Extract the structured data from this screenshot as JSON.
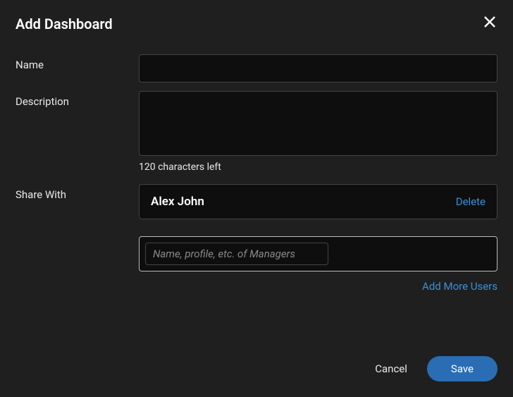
{
  "dialog": {
    "title": "Add Dashboard"
  },
  "form": {
    "name_label": "Name",
    "name_value": "",
    "description_label": "Description",
    "description_value": "",
    "char_counter": "120 characters left",
    "share_label": "Share With"
  },
  "share": {
    "user_name": "Alex John",
    "delete_label": "Delete",
    "search_placeholder": "Name, profile, etc. of Managers",
    "add_more_label": "Add More Users"
  },
  "footer": {
    "cancel_label": "Cancel",
    "save_label": "Save"
  }
}
